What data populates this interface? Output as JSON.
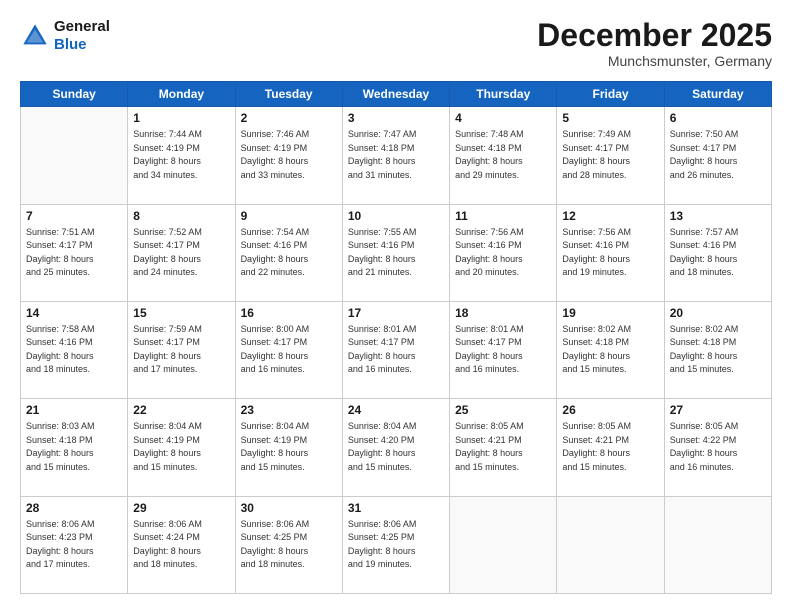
{
  "header": {
    "logo_line1": "General",
    "logo_line2": "Blue",
    "month_title": "December 2025",
    "location": "Munchsmunster, Germany"
  },
  "days_of_week": [
    "Sunday",
    "Monday",
    "Tuesday",
    "Wednesday",
    "Thursday",
    "Friday",
    "Saturday"
  ],
  "weeks": [
    [
      {
        "day": "",
        "info": ""
      },
      {
        "day": "1",
        "info": "Sunrise: 7:44 AM\nSunset: 4:19 PM\nDaylight: 8 hours\nand 34 minutes."
      },
      {
        "day": "2",
        "info": "Sunrise: 7:46 AM\nSunset: 4:19 PM\nDaylight: 8 hours\nand 33 minutes."
      },
      {
        "day": "3",
        "info": "Sunrise: 7:47 AM\nSunset: 4:18 PM\nDaylight: 8 hours\nand 31 minutes."
      },
      {
        "day": "4",
        "info": "Sunrise: 7:48 AM\nSunset: 4:18 PM\nDaylight: 8 hours\nand 29 minutes."
      },
      {
        "day": "5",
        "info": "Sunrise: 7:49 AM\nSunset: 4:17 PM\nDaylight: 8 hours\nand 28 minutes."
      },
      {
        "day": "6",
        "info": "Sunrise: 7:50 AM\nSunset: 4:17 PM\nDaylight: 8 hours\nand 26 minutes."
      }
    ],
    [
      {
        "day": "7",
        "info": "Sunrise: 7:51 AM\nSunset: 4:17 PM\nDaylight: 8 hours\nand 25 minutes."
      },
      {
        "day": "8",
        "info": "Sunrise: 7:52 AM\nSunset: 4:17 PM\nDaylight: 8 hours\nand 24 minutes."
      },
      {
        "day": "9",
        "info": "Sunrise: 7:54 AM\nSunset: 4:16 PM\nDaylight: 8 hours\nand 22 minutes."
      },
      {
        "day": "10",
        "info": "Sunrise: 7:55 AM\nSunset: 4:16 PM\nDaylight: 8 hours\nand 21 minutes."
      },
      {
        "day": "11",
        "info": "Sunrise: 7:56 AM\nSunset: 4:16 PM\nDaylight: 8 hours\nand 20 minutes."
      },
      {
        "day": "12",
        "info": "Sunrise: 7:56 AM\nSunset: 4:16 PM\nDaylight: 8 hours\nand 19 minutes."
      },
      {
        "day": "13",
        "info": "Sunrise: 7:57 AM\nSunset: 4:16 PM\nDaylight: 8 hours\nand 18 minutes."
      }
    ],
    [
      {
        "day": "14",
        "info": "Sunrise: 7:58 AM\nSunset: 4:16 PM\nDaylight: 8 hours\nand 18 minutes."
      },
      {
        "day": "15",
        "info": "Sunrise: 7:59 AM\nSunset: 4:17 PM\nDaylight: 8 hours\nand 17 minutes."
      },
      {
        "day": "16",
        "info": "Sunrise: 8:00 AM\nSunset: 4:17 PM\nDaylight: 8 hours\nand 16 minutes."
      },
      {
        "day": "17",
        "info": "Sunrise: 8:01 AM\nSunset: 4:17 PM\nDaylight: 8 hours\nand 16 minutes."
      },
      {
        "day": "18",
        "info": "Sunrise: 8:01 AM\nSunset: 4:17 PM\nDaylight: 8 hours\nand 16 minutes."
      },
      {
        "day": "19",
        "info": "Sunrise: 8:02 AM\nSunset: 4:18 PM\nDaylight: 8 hours\nand 15 minutes."
      },
      {
        "day": "20",
        "info": "Sunrise: 8:02 AM\nSunset: 4:18 PM\nDaylight: 8 hours\nand 15 minutes."
      }
    ],
    [
      {
        "day": "21",
        "info": "Sunrise: 8:03 AM\nSunset: 4:18 PM\nDaylight: 8 hours\nand 15 minutes."
      },
      {
        "day": "22",
        "info": "Sunrise: 8:04 AM\nSunset: 4:19 PM\nDaylight: 8 hours\nand 15 minutes."
      },
      {
        "day": "23",
        "info": "Sunrise: 8:04 AM\nSunset: 4:19 PM\nDaylight: 8 hours\nand 15 minutes."
      },
      {
        "day": "24",
        "info": "Sunrise: 8:04 AM\nSunset: 4:20 PM\nDaylight: 8 hours\nand 15 minutes."
      },
      {
        "day": "25",
        "info": "Sunrise: 8:05 AM\nSunset: 4:21 PM\nDaylight: 8 hours\nand 15 minutes."
      },
      {
        "day": "26",
        "info": "Sunrise: 8:05 AM\nSunset: 4:21 PM\nDaylight: 8 hours\nand 15 minutes."
      },
      {
        "day": "27",
        "info": "Sunrise: 8:05 AM\nSunset: 4:22 PM\nDaylight: 8 hours\nand 16 minutes."
      }
    ],
    [
      {
        "day": "28",
        "info": "Sunrise: 8:06 AM\nSunset: 4:23 PM\nDaylight: 8 hours\nand 17 minutes."
      },
      {
        "day": "29",
        "info": "Sunrise: 8:06 AM\nSunset: 4:24 PM\nDaylight: 8 hours\nand 18 minutes."
      },
      {
        "day": "30",
        "info": "Sunrise: 8:06 AM\nSunset: 4:25 PM\nDaylight: 8 hours\nand 18 minutes."
      },
      {
        "day": "31",
        "info": "Sunrise: 8:06 AM\nSunset: 4:25 PM\nDaylight: 8 hours\nand 19 minutes."
      },
      {
        "day": "",
        "info": ""
      },
      {
        "day": "",
        "info": ""
      },
      {
        "day": "",
        "info": ""
      }
    ]
  ]
}
